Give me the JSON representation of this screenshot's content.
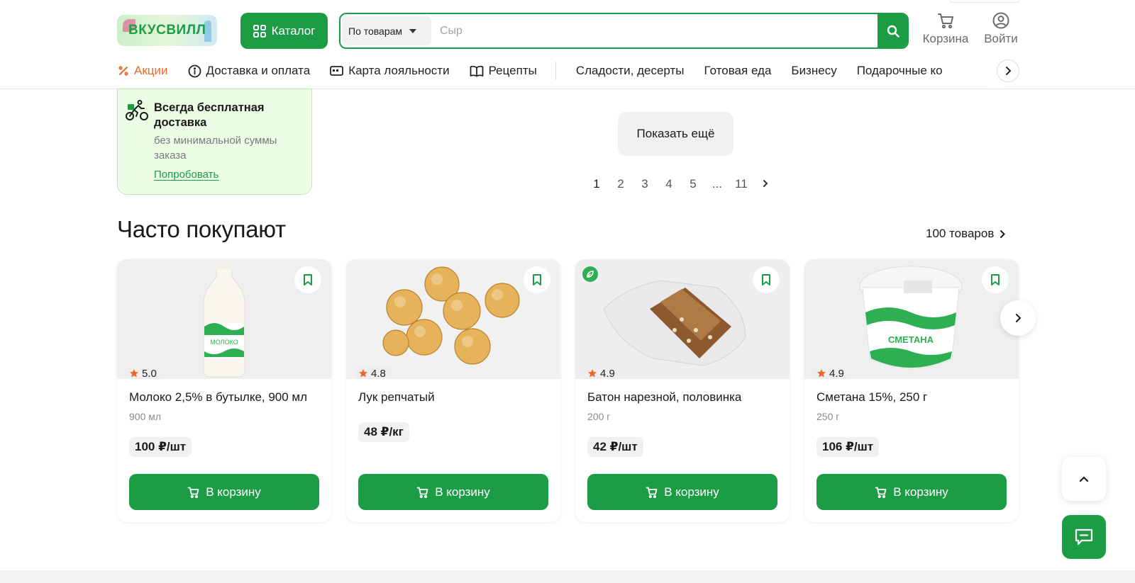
{
  "header": {
    "logo_text": "ВКУСВИЛЛ",
    "catalog_label": "Каталог",
    "search": {
      "scope_label": "По товарам",
      "placeholder": "Сыр",
      "value": ""
    },
    "cart_label": "Корзина",
    "login_label": "Войти",
    "nav": {
      "promo": "Акции",
      "delivery": "Доставка и оплата",
      "loyalty": "Карта лояльности",
      "recipes": "Рецепты",
      "categories": [
        "Сладости, десерты",
        "Готовая еда",
        "Бизнесу",
        "Подарочные ко"
      ]
    }
  },
  "promo_card": {
    "title": "Всегда бесплатная доставка",
    "subtitle": "без минимальной суммы заказа",
    "link": "Попробовать"
  },
  "listing": {
    "show_more": "Показать ещё",
    "pagination": [
      "1",
      "2",
      "3",
      "4",
      "5",
      "...",
      "11"
    ],
    "current_page": "1"
  },
  "section": {
    "title": "Часто покупают",
    "count_link": "100 товаров",
    "products": [
      {
        "name": "Молоко 2,5% в бутылке, 900 мл",
        "weight": "900 мл",
        "price": "100 ₽/шт",
        "rating": "5.0",
        "buy": "В корзину",
        "eco": false
      },
      {
        "name": "Лук репчатый",
        "weight": "",
        "price": "48 ₽/кг",
        "rating": "4.8",
        "buy": "В корзину",
        "eco": false
      },
      {
        "name": "Батон нарезной, половинка",
        "weight": "200 г",
        "price": "42 ₽/шт",
        "rating": "4.9",
        "buy": "В корзину",
        "eco": true
      },
      {
        "name": "Сметана 15%, 250 г",
        "weight": "250 г",
        "price": "106 ₽/шт",
        "rating": "4.9",
        "buy": "В корзину",
        "eco": false
      }
    ]
  },
  "colors": {
    "brand_green": "#1c9c44",
    "promo_orange": "#e8692b",
    "rating_star": "#e8692b"
  }
}
